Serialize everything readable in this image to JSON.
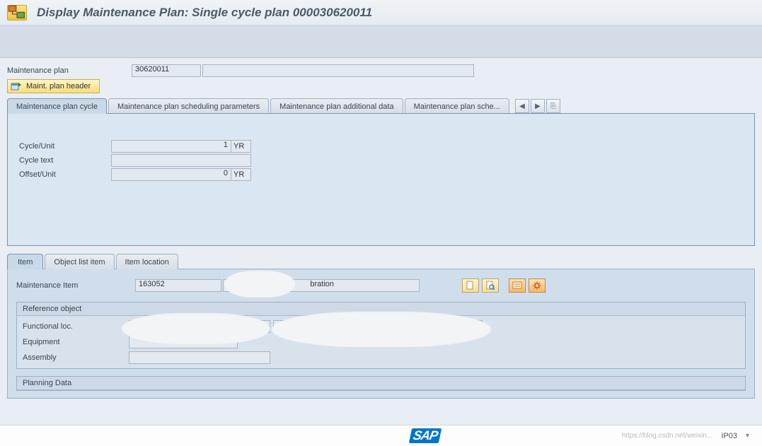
{
  "header": {
    "title": "Display Maintenance Plan: Single cycle plan 000030620011"
  },
  "main": {
    "maint_plan_label": "Maintenance plan",
    "maint_plan_value": "30620011",
    "maint_plan_desc": "",
    "hdr_button": "Maint. plan header"
  },
  "tabs": {
    "items": [
      {
        "label": "Maintenance plan cycle"
      },
      {
        "label": "Maintenance plan scheduling parameters"
      },
      {
        "label": "Maintenance plan additional data"
      },
      {
        "label": "Maintenance plan sche..."
      }
    ],
    "nav_prev": "◀",
    "nav_next": "▶",
    "nav_list": "⎘"
  },
  "cycle": {
    "cycle_unit_label": "Cycle/Unit",
    "cycle_value": "1",
    "cycle_unit": "YR",
    "cycle_text_label": "Cycle text",
    "cycle_text_value": "",
    "offset_label": "Offset/Unit",
    "offset_value": "0",
    "offset_unit": "YR"
  },
  "sub_tabs": {
    "items": [
      {
        "label": "Item"
      },
      {
        "label": "Object list item"
      },
      {
        "label": "Item location"
      }
    ]
  },
  "item": {
    "maint_item_label": "Maintenance Item",
    "maint_item_value": "163052",
    "maint_item_desc": "bration",
    "ref_object_title": "Reference object",
    "func_loc_label": "Functional loc.",
    "func_loc_value": "",
    "func_loc_desc": "",
    "equipment_label": "Equipment",
    "equipment_value": "",
    "assembly_label": "Assembly",
    "assembly_value": "",
    "planning_title": "Planning Data"
  },
  "footer": {
    "tcode": "IP03",
    "watermark": "https://blog.csdn.net/weixin..."
  }
}
